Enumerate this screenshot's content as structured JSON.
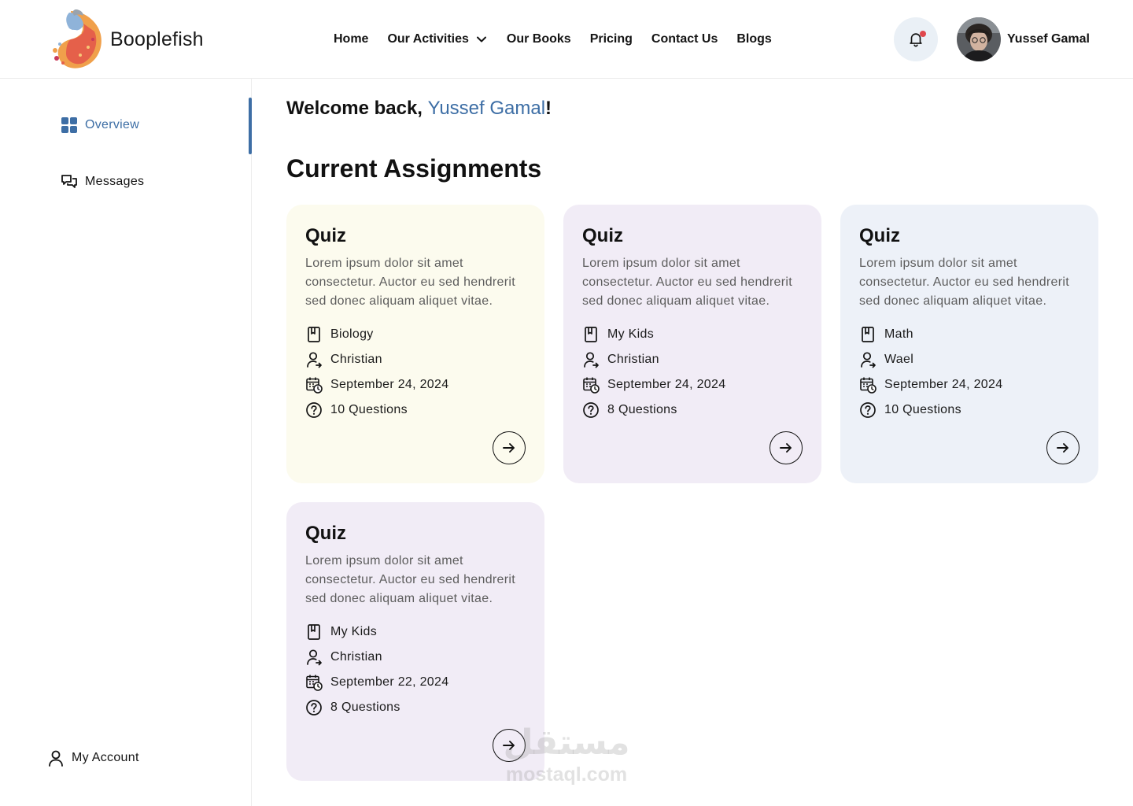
{
  "brand": {
    "name": "Booplefish"
  },
  "nav": {
    "items": [
      {
        "label": "Home"
      },
      {
        "label": "Our Activities",
        "has_dropdown": true
      },
      {
        "label": "Our Books"
      },
      {
        "label": "Pricing"
      },
      {
        "label": "Contact Us"
      },
      {
        "label": "Blogs"
      }
    ]
  },
  "header": {
    "notifications_icon": "bell-icon",
    "has_unread": true,
    "user_name": "Yussef Gamal"
  },
  "sidebar": {
    "items": [
      {
        "label": "Overview",
        "icon": "grid-icon",
        "active": true
      },
      {
        "label": "Messages",
        "icon": "chat-icon",
        "active": false
      }
    ],
    "account_label": "My Account"
  },
  "main": {
    "welcome_prefix": "Welcome back, ",
    "welcome_name": "Yussef Gamal",
    "welcome_suffix": "!",
    "section_title": "Current Assignments",
    "cards": [
      {
        "title": "Quiz",
        "description": "Lorem ipsum dolor sit amet consectetur. Auctor eu sed hendrerit sed donec aliquam aliquet vitae.",
        "subject": "Biology",
        "teacher": "Christian",
        "date": "September 24, 2024",
        "questions": "10 Questions",
        "color": "#fcfbee"
      },
      {
        "title": "Quiz",
        "description": "Lorem ipsum dolor sit amet consectetur. Auctor eu sed hendrerit sed donec aliquam aliquet vitae.",
        "subject": "My Kids",
        "teacher": "Christian",
        "date": "September 24, 2024",
        "questions": "8 Questions",
        "color": "#f1ecf6"
      },
      {
        "title": "Quiz",
        "description": "Lorem ipsum dolor sit amet consectetur. Auctor eu sed hendrerit sed donec aliquam aliquet vitae.",
        "subject": "Math",
        "teacher": "Wael",
        "date": "September 24, 2024",
        "questions": "10 Questions",
        "color": "#edf1f8"
      },
      {
        "title": "Quiz",
        "description": "Lorem ipsum dolor sit amet consectetur. Auctor eu sed hendrerit sed donec aliquam aliquet vitae.",
        "subject": "My Kids",
        "teacher": "Christian",
        "date": "September 22, 2024",
        "questions": "8 Questions",
        "color": "#f1ecf6"
      }
    ]
  },
  "watermark": {
    "arabic": "مستقل",
    "latin": "mostaql.com"
  },
  "colors": {
    "accent": "#3d6ea5",
    "notification_dot": "#e0474c",
    "bell_bg": "#eaf0f6"
  }
}
